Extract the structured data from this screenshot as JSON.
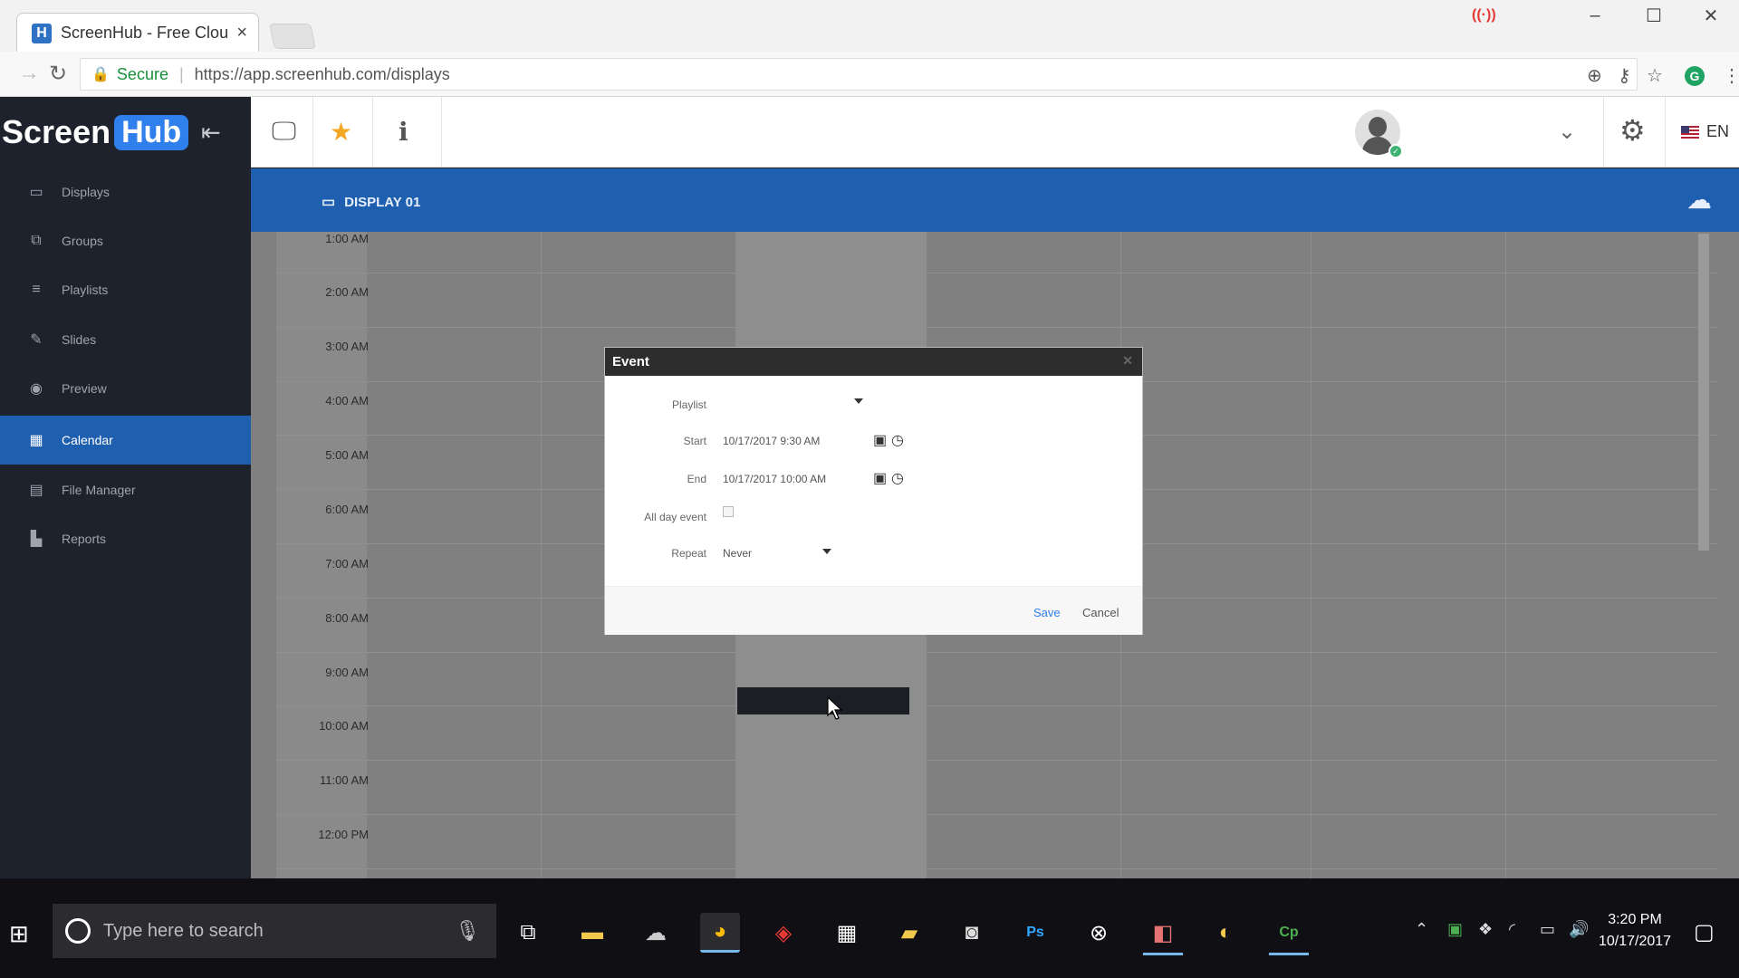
{
  "browser": {
    "tab_title": "ScreenHub - Free Clou",
    "tab_close": "×",
    "favicon": "H",
    "secure_label": "Secure",
    "url": "https://app.screenhub.com/displays",
    "window_controls": [
      "–",
      "☐",
      "✕"
    ]
  },
  "app": {
    "brand_screen": "Screen",
    "brand_hub": "Hub",
    "lang": "EN",
    "display_title": "DISPLAY 01"
  },
  "sidebar": {
    "items": [
      {
        "label": "Displays",
        "icon": "monitor-icon"
      },
      {
        "label": "Groups",
        "icon": "groups-icon"
      },
      {
        "label": "Playlists",
        "icon": "list-icon"
      },
      {
        "label": "Slides",
        "icon": "pencil-icon"
      },
      {
        "label": "Preview",
        "icon": "eye-icon"
      },
      {
        "label": "Calendar",
        "icon": "calendar-icon",
        "active": true
      },
      {
        "label": "File Manager",
        "icon": "folder-icon"
      },
      {
        "label": "Reports",
        "icon": "chart-icon"
      }
    ]
  },
  "calendar": {
    "times": [
      "1:00 AM",
      "2:00 AM",
      "3:00 AM",
      "4:00 AM",
      "5:00 AM",
      "6:00 AM",
      "7:00 AM",
      "8:00 AM",
      "9:00 AM",
      "10:00 AM",
      "11:00 AM",
      "12:00 PM"
    ]
  },
  "modal": {
    "title": "Event",
    "playlist_label": "Playlist",
    "playlist_value": "",
    "start_label": "Start",
    "start_value": "10/17/2017 9:30 AM",
    "end_label": "End",
    "end_value": "10/17/2017 10:00 AM",
    "allday_label": "All day event",
    "allday_checked": false,
    "repeat_label": "Repeat",
    "repeat_value": "Never",
    "save_label": "Save",
    "cancel_label": "Cancel"
  },
  "taskbar": {
    "search_placeholder": "Type here to search",
    "time": "3:20 PM",
    "date": "10/17/2017"
  },
  "colors": {
    "sidebar_bg": "#1e222c",
    "accent": "#1f5fb0",
    "brand_hub": "#2f80ed"
  }
}
